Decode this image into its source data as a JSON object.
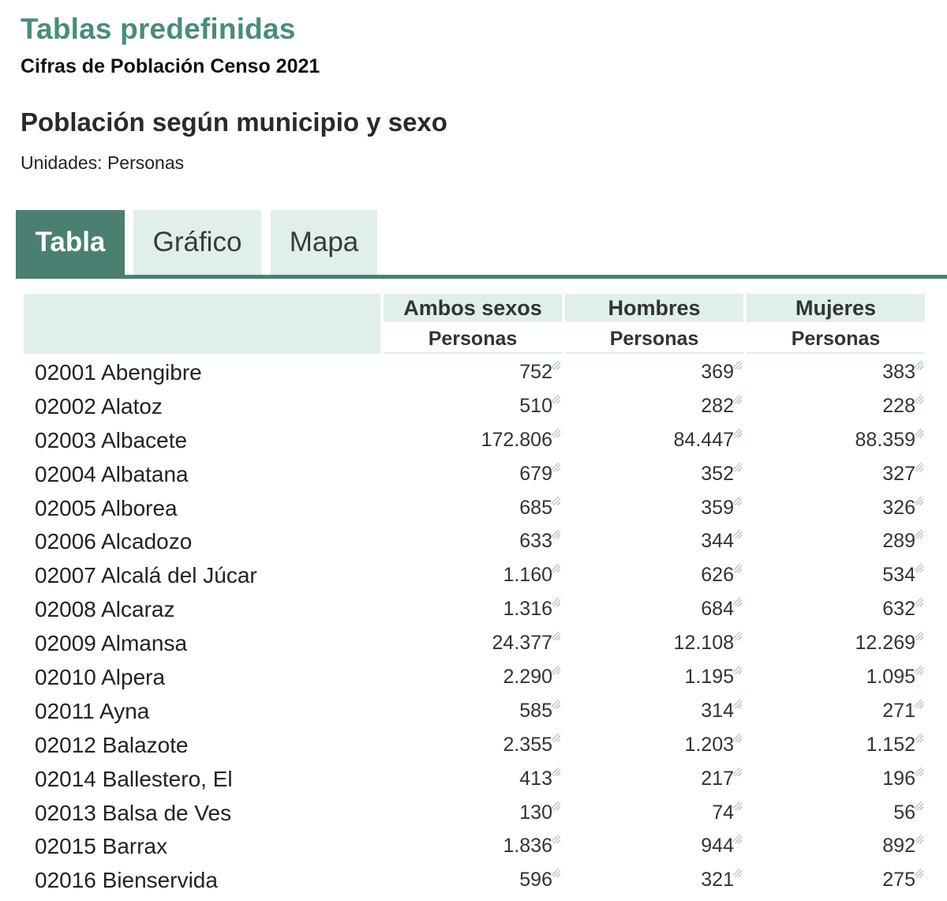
{
  "header": {
    "title": "Tablas predefinidas",
    "subtitle": "Cifras de Población Censo 2021",
    "table_title": "Población según municipio y sexo",
    "units": "Unidades: Personas"
  },
  "tabs": [
    {
      "label": "Tabla",
      "active": true
    },
    {
      "label": "Gráfico",
      "active": false
    },
    {
      "label": "Mapa",
      "active": false
    }
  ],
  "colors": {
    "title_green": "#4b8b7b",
    "tab_active": "#4b7f72",
    "tab_inactive": "#e0eeec",
    "header_bg": "#e0eeec"
  },
  "table": {
    "columns": [
      {
        "label": "Ambos sexos",
        "unit": "Personas"
      },
      {
        "label": "Hombres",
        "unit": "Personas"
      },
      {
        "label": "Mujeres",
        "unit": "Personas"
      }
    ],
    "rows": [
      {
        "name": "02001 Abengibre",
        "values": [
          "752",
          "369",
          "383"
        ]
      },
      {
        "name": "02002 Alatoz",
        "values": [
          "510",
          "282",
          "228"
        ]
      },
      {
        "name": "02003 Albacete",
        "values": [
          "172.806",
          "84.447",
          "88.359"
        ]
      },
      {
        "name": "02004 Albatana",
        "values": [
          "679",
          "352",
          "327"
        ]
      },
      {
        "name": "02005 Alborea",
        "values": [
          "685",
          "359",
          "326"
        ]
      },
      {
        "name": "02006 Alcadozo",
        "values": [
          "633",
          "344",
          "289"
        ]
      },
      {
        "name": "02007 Alcalá del Júcar",
        "values": [
          "1.160",
          "626",
          "534"
        ]
      },
      {
        "name": "02008 Alcaraz",
        "values": [
          "1.316",
          "684",
          "632"
        ]
      },
      {
        "name": "02009 Almansa",
        "values": [
          "24.377",
          "12.108",
          "12.269"
        ]
      },
      {
        "name": "02010 Alpera",
        "values": [
          "2.290",
          "1.195",
          "1.095"
        ]
      },
      {
        "name": "02011 Ayna",
        "values": [
          "585",
          "314",
          "271"
        ]
      },
      {
        "name": "02012 Balazote",
        "values": [
          "2.355",
          "1.203",
          "1.152"
        ]
      },
      {
        "name": "02014 Ballestero, El",
        "values": [
          "413",
          "217",
          "196"
        ]
      },
      {
        "name": "02013 Balsa de Ves",
        "values": [
          "130",
          "74",
          "56"
        ]
      },
      {
        "name": "02015 Barrax",
        "values": [
          "1.836",
          "944",
          "892"
        ]
      },
      {
        "name": "02016 Bienservida",
        "values": [
          "596",
          "321",
          "275"
        ]
      }
    ]
  }
}
